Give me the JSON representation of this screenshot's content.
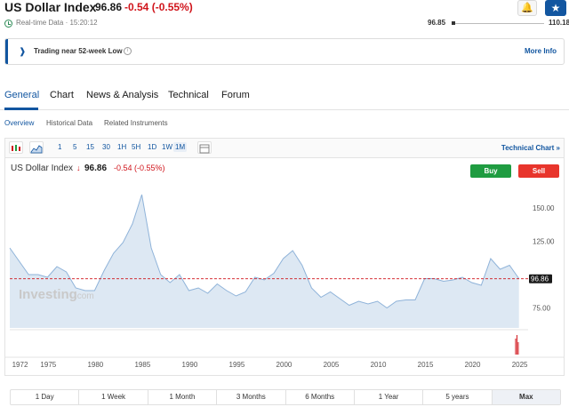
{
  "header": {
    "title": "US Dollar Index",
    "price": "96.86",
    "change": "-0.54",
    "change_pct": "(-0.55%)"
  },
  "realtime": {
    "text": "Real-time Data · 15:20:12",
    "range_low": "96.85",
    "range_high": "110.18"
  },
  "alert": {
    "text": "Trading near 52-week Low",
    "info_icon": "i",
    "link": "More Info"
  },
  "tabs": [
    "General",
    "Chart",
    "News & Analysis",
    "Technical",
    "Forum"
  ],
  "subtabs": [
    "Overview",
    "Historical Data",
    "Related Instruments"
  ],
  "toolbar": {
    "intervals": [
      "1",
      "5",
      "15",
      "30",
      "1H",
      "5H",
      "1D",
      "1W",
      "1M"
    ],
    "selected_interval": "1M",
    "technical_chart": "Technical Chart »"
  },
  "legend": {
    "title": "US Dollar Index",
    "arrow": "↓",
    "price": "96.86",
    "change": "-0.54 (-0.55%)"
  },
  "buttons": {
    "buy": "Buy",
    "sell": "Sell"
  },
  "ranges": [
    "1 Day",
    "1 Week",
    "1 Month",
    "3 Months",
    "6 Months",
    "1 Year",
    "5 years",
    "Max"
  ],
  "active_range": "Max",
  "colors": {
    "accent": "#1256a0",
    "down": "#d0141b",
    "buy": "#1f9c41",
    "sell": "#e8352c",
    "line": "#8fb3d9",
    "fill": "#dde8f3"
  },
  "chart_data": {
    "type": "area",
    "x": [
      1971,
      1972,
      1973,
      1974,
      1975,
      1976,
      1977,
      1978,
      1979,
      1980,
      1981,
      1982,
      1983,
      1984,
      1985,
      1986,
      1987,
      1988,
      1989,
      1990,
      1991,
      1992,
      1993,
      1994,
      1995,
      1996,
      1997,
      1998,
      1999,
      2000,
      2001,
      2002,
      2003,
      2004,
      2005,
      2006,
      2007,
      2008,
      2009,
      2010,
      2011,
      2012,
      2013,
      2014,
      2015,
      2016,
      2017,
      2018,
      2019,
      2020,
      2021,
      2022,
      2023,
      2024,
      2025
    ],
    "values": [
      120,
      110,
      100,
      100,
      98,
      106,
      102,
      90,
      88,
      88,
      103,
      116,
      124,
      138,
      160,
      120,
      100,
      94,
      100,
      88,
      90,
      86,
      93,
      88,
      84,
      87,
      98,
      96,
      101,
      112,
      118,
      107,
      90,
      83,
      87,
      82,
      77,
      80,
      78,
      80,
      75,
      80,
      81,
      81,
      97,
      97,
      95,
      96,
      98,
      94,
      92,
      112,
      104,
      107,
      97
    ],
    "xticks": [
      "1972",
      "1975",
      "1980",
      "1985",
      "1990",
      "1995",
      "2000",
      "2005",
      "2010",
      "2015",
      "2020",
      "2025"
    ],
    "ytick_labels": [
      "150.00",
      "125.00",
      "100.00",
      "75.00"
    ],
    "yticks": [
      150,
      125,
      100,
      75
    ],
    "ylim": [
      60,
      170
    ],
    "current_value": 96.86,
    "current_label": "96.86",
    "watermark": "Investing",
    "watermark_suffix": ".com",
    "volume_values": [
      18,
      22,
      14
    ]
  }
}
